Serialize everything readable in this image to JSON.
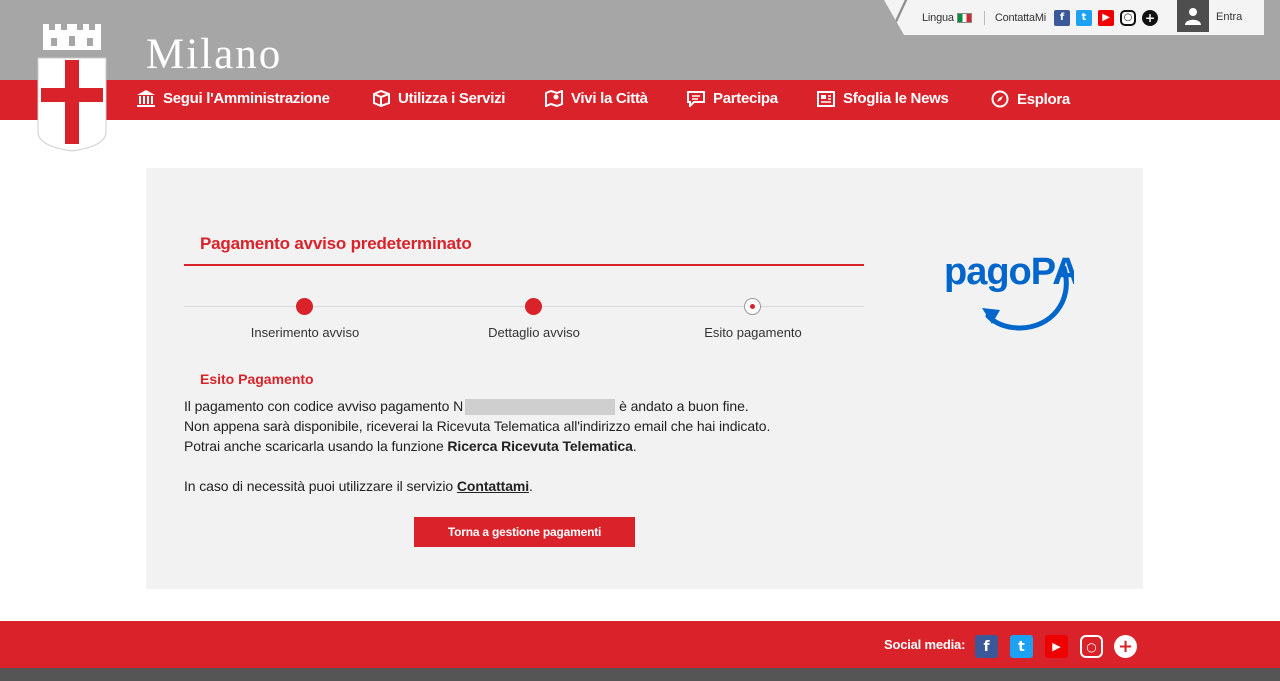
{
  "header": {
    "brand": "Milano",
    "utility": {
      "lingua_label": "Lingua",
      "contattami_label": "ContattaMi",
      "login_label": "Entra"
    },
    "nav": [
      {
        "label": "Segui l'Amministrazione",
        "icon": "building-columns-icon"
      },
      {
        "label": "Utilizza i Servizi",
        "icon": "services-box-icon"
      },
      {
        "label": "Vivi la Città",
        "icon": "city-map-icon"
      },
      {
        "label": "Partecipa",
        "icon": "speech-bubble-icon"
      },
      {
        "label": "Sfoglia le News",
        "icon": "newspaper-icon"
      },
      {
        "label": "Esplora",
        "icon": "compass-icon"
      }
    ]
  },
  "main": {
    "title": "Pagamento avviso predeterminato",
    "steps": [
      {
        "label": "Inserimento avviso",
        "state": "done"
      },
      {
        "label": "Dettaglio avviso",
        "state": "done"
      },
      {
        "label": "Esito pagamento",
        "state": "current"
      }
    ],
    "esito_title": "Esito Pagamento",
    "line1_a": "Il pagamento con codice avviso pagamento N",
    "line1_b": "è andato a buon fine.",
    "line2": "Non appena sarà disponibile, riceverai la Ricevuta Telematica all'indirizzo email che hai indicato.",
    "line3_a": "Potrai anche scaricarla usando la funzione ",
    "line3_b": "Ricerca Ricevuta Telematica",
    "line3_c": ".",
    "line4_a": "In caso di necessità puoi utilizzare il servizio ",
    "line4_link": "Contattami",
    "line4_c": ".",
    "back_button": "Torna a gestione pagamenti",
    "logo_text": "pagoPA"
  },
  "footer": {
    "social_label": "Social media:"
  },
  "colors": {
    "brand_red": "#d9222a",
    "header_grey": "#a6a6a6",
    "panel_bg": "#f2f2f2",
    "pagopa_blue": "#0066cc"
  }
}
